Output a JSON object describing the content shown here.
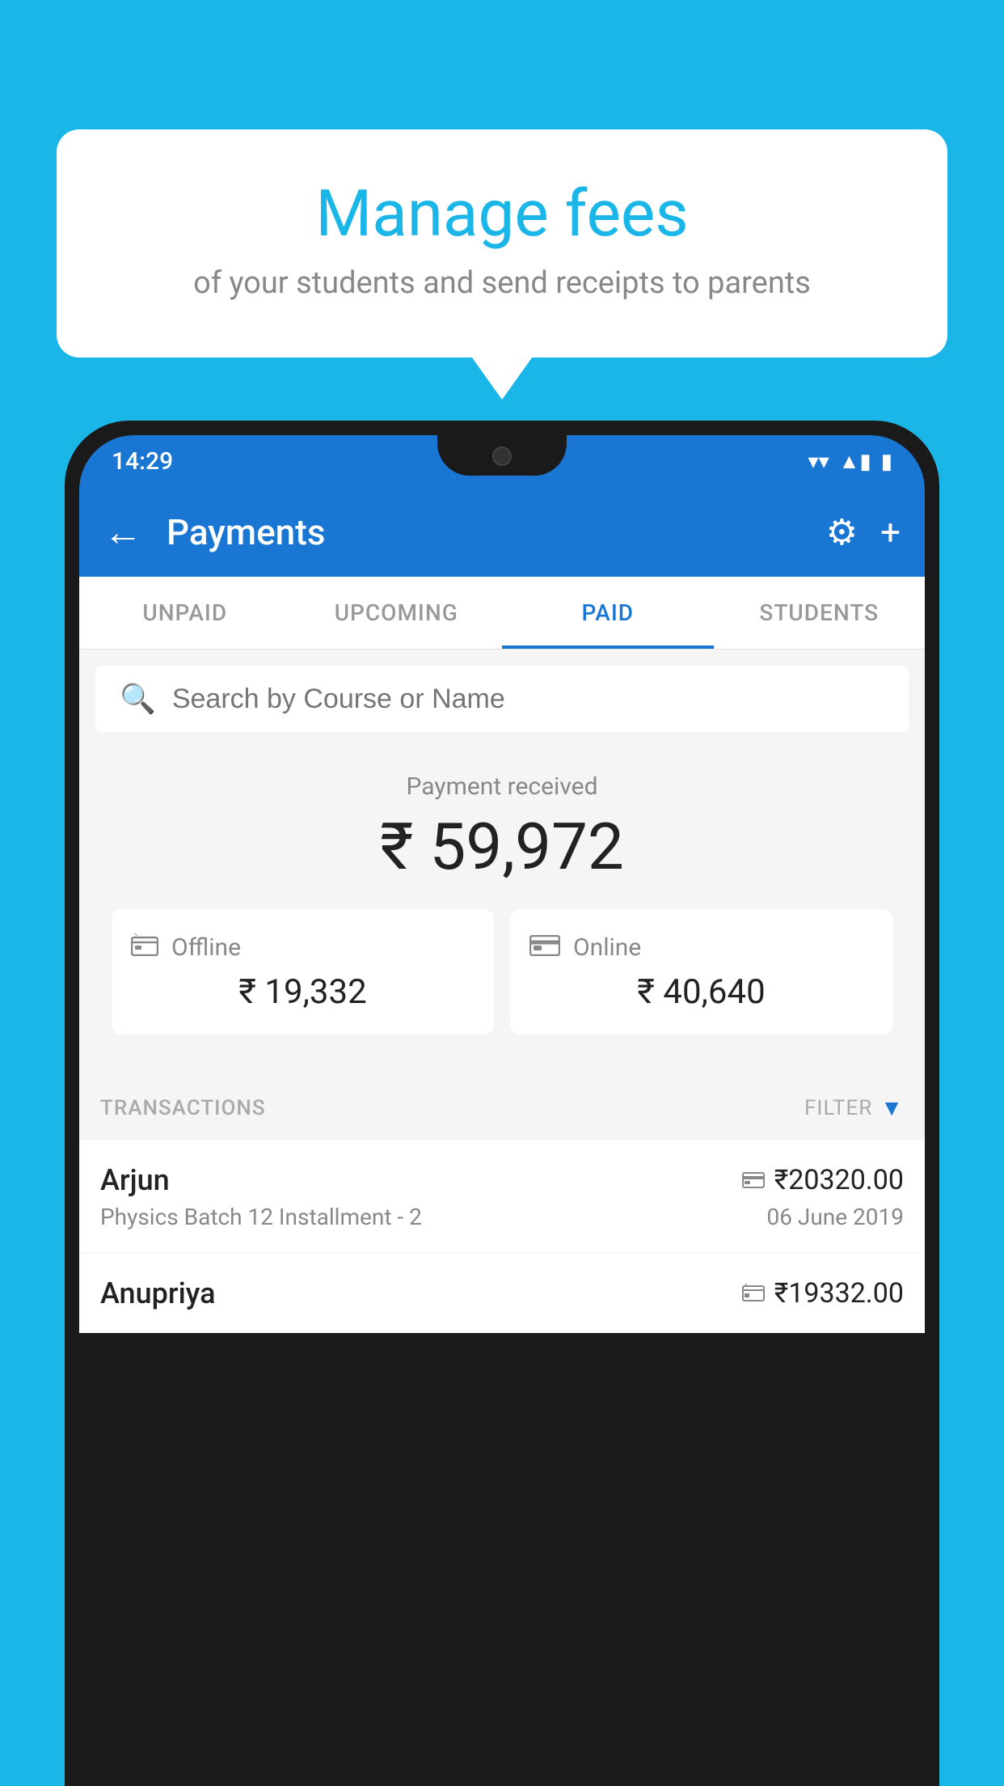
{
  "page": {
    "background_color": "#1ab6e8"
  },
  "bubble": {
    "title": "Manage fees",
    "subtitle": "of your students and send receipts to parents"
  },
  "status_bar": {
    "time": "14:29",
    "wifi_icon": "▼",
    "signal_icon": "▲",
    "battery_icon": "▮"
  },
  "app_bar": {
    "title": "Payments",
    "back_label": "←",
    "gear_label": "⚙",
    "plus_label": "+"
  },
  "tabs": [
    {
      "id": "unpaid",
      "label": "UNPAID",
      "active": false
    },
    {
      "id": "upcoming",
      "label": "UPCOMING",
      "active": false
    },
    {
      "id": "paid",
      "label": "PAID",
      "active": true
    },
    {
      "id": "students",
      "label": "STUDENTS",
      "active": false
    }
  ],
  "search": {
    "placeholder": "Search by Course or Name",
    "icon": "🔍"
  },
  "payment_summary": {
    "label": "Payment received",
    "amount": "₹ 59,972"
  },
  "payment_cards": [
    {
      "type": "Offline",
      "amount": "₹ 19,332",
      "icon": "💳"
    },
    {
      "type": "Online",
      "amount": "₹ 40,640",
      "icon": "💳"
    }
  ],
  "transactions_section": {
    "label": "TRANSACTIONS",
    "filter_label": "FILTER",
    "filter_icon": "▼"
  },
  "transactions": [
    {
      "name": "Arjun",
      "description": "Physics Batch 12 Installment - 2",
      "amount": "₹20320.00",
      "date": "06 June 2019",
      "payment_type": "online"
    },
    {
      "name": "Anupriya",
      "description": "",
      "amount": "₹19332.00",
      "date": "",
      "payment_type": "offline"
    }
  ]
}
